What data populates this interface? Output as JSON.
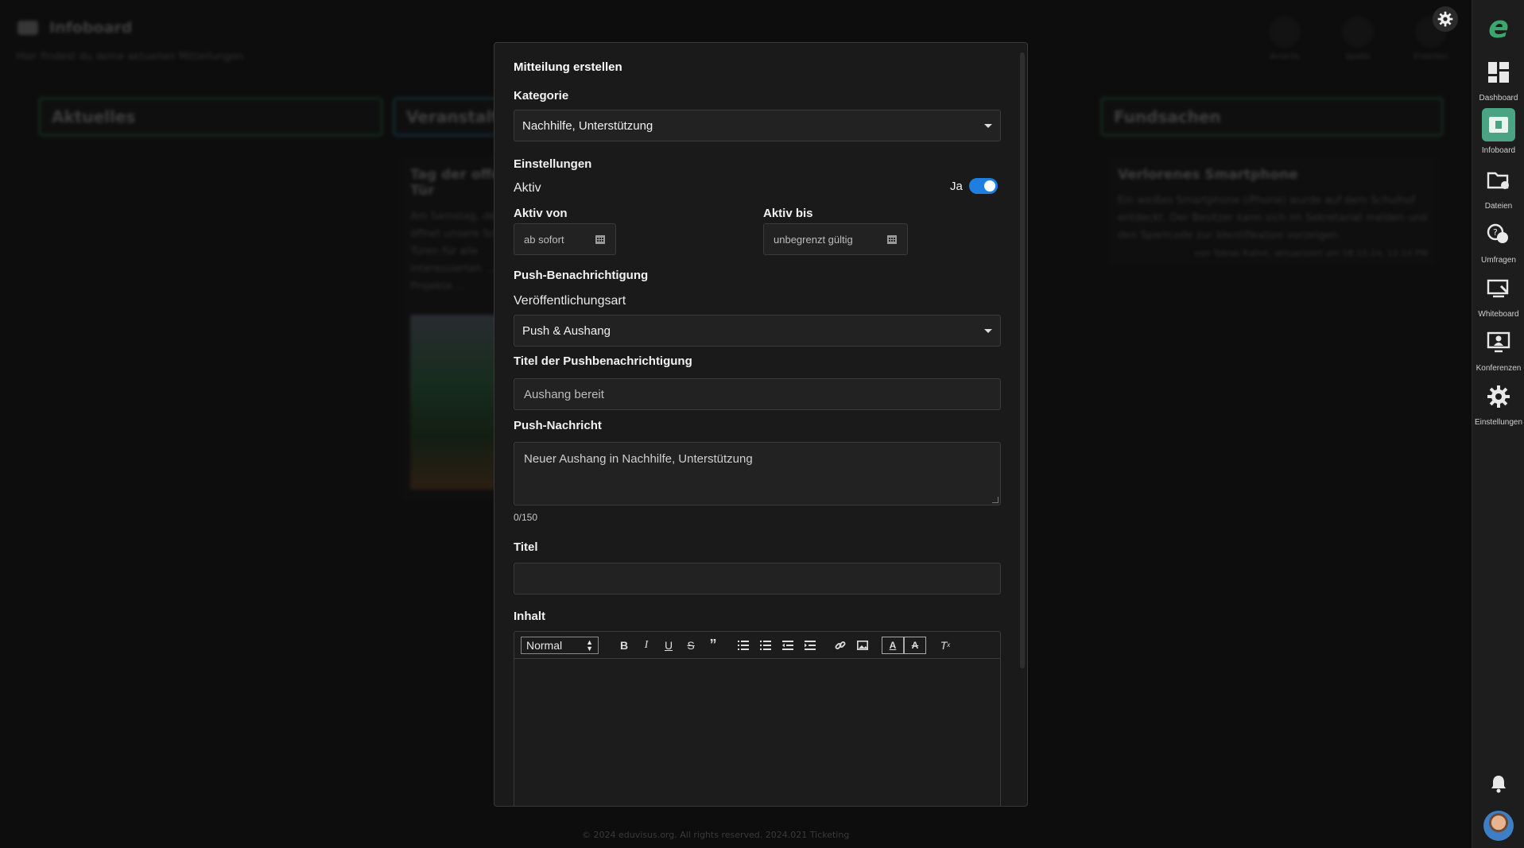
{
  "page": {
    "title": "Infoboard",
    "subtitle": "Hier findest du deine aktuellen Mitteilungen",
    "tools": [
      "Ansicht",
      "Spalte",
      "Erstellen"
    ],
    "columns": [
      "Aktuelles",
      "Veranstaltungen",
      "Fundsachen"
    ],
    "cards": {
      "card1_title": "Tag der offenen Tür",
      "card1_text": "Am Samstag, dem ... öffnet unsere Schule ihre Türen für alle Interessierten ... Schule, Projekte ...",
      "card2_title": "Verlorenes Smartphone",
      "card2_text": "Ein weißes Smartphone (iPhone) wurde auf dem Schulhof entdeckt. Der Besitzer kann sich im Sekretariat melden und den Sperrcode zur Identifikation vorzeigen.",
      "card2_meta": "von Tobias Kahnt, aktualisiert am 08.10.24, 12:14 PM"
    },
    "footer": "© 2024 eduvisus.org. All rights reserved. 2024.021  Ticketing"
  },
  "sidebar": {
    "items": [
      {
        "label": "Dashboard",
        "icon": "dashboard-icon"
      },
      {
        "label": "Infoboard",
        "icon": "infoboard-icon"
      },
      {
        "label": "Dateien",
        "icon": "folder-icon"
      },
      {
        "label": "Umfragen",
        "icon": "survey-icon"
      },
      {
        "label": "Whiteboard",
        "icon": "whiteboard-icon"
      },
      {
        "label": "Konferenzen",
        "icon": "conference-icon"
      },
      {
        "label": "Einstellungen",
        "icon": "gear-icon"
      }
    ]
  },
  "modal": {
    "title": "Mitteilung erstellen",
    "kategorie_label": "Kategorie",
    "kategorie_value": "Nachhilfe, Unterstützung",
    "einstellungen_label": "Einstellungen",
    "aktiv_label": "Aktiv",
    "aktiv_toggle_label": "Ja",
    "aktiv_von_label": "Aktiv von",
    "aktiv_von_value": "ab sofort",
    "aktiv_bis_label": "Aktiv bis",
    "aktiv_bis_value": "unbegrenzt gültig",
    "push_section_label": "Push-Benachrichtigung",
    "veroeffentlichungsart_label": "Veröffentlichungsart",
    "veroeffentlichungsart_value": "Push & Aushang",
    "push_title_label": "Titel der Pushbenachrichtigung",
    "push_title_placeholder": "Aushang bereit",
    "push_message_label": "Push-Nachricht",
    "push_message_placeholder": "Neuer Aushang in Nachhilfe, Unterstützung",
    "push_message_counter": "0/150",
    "titel_label": "Titel",
    "titel_value": "",
    "inhalt_label": "Inhalt",
    "editor_format": "Normal"
  },
  "colors": {
    "accent": "#1f7fe0",
    "brand": "#3aa86c",
    "sidebar_active": "#4aa383"
  }
}
